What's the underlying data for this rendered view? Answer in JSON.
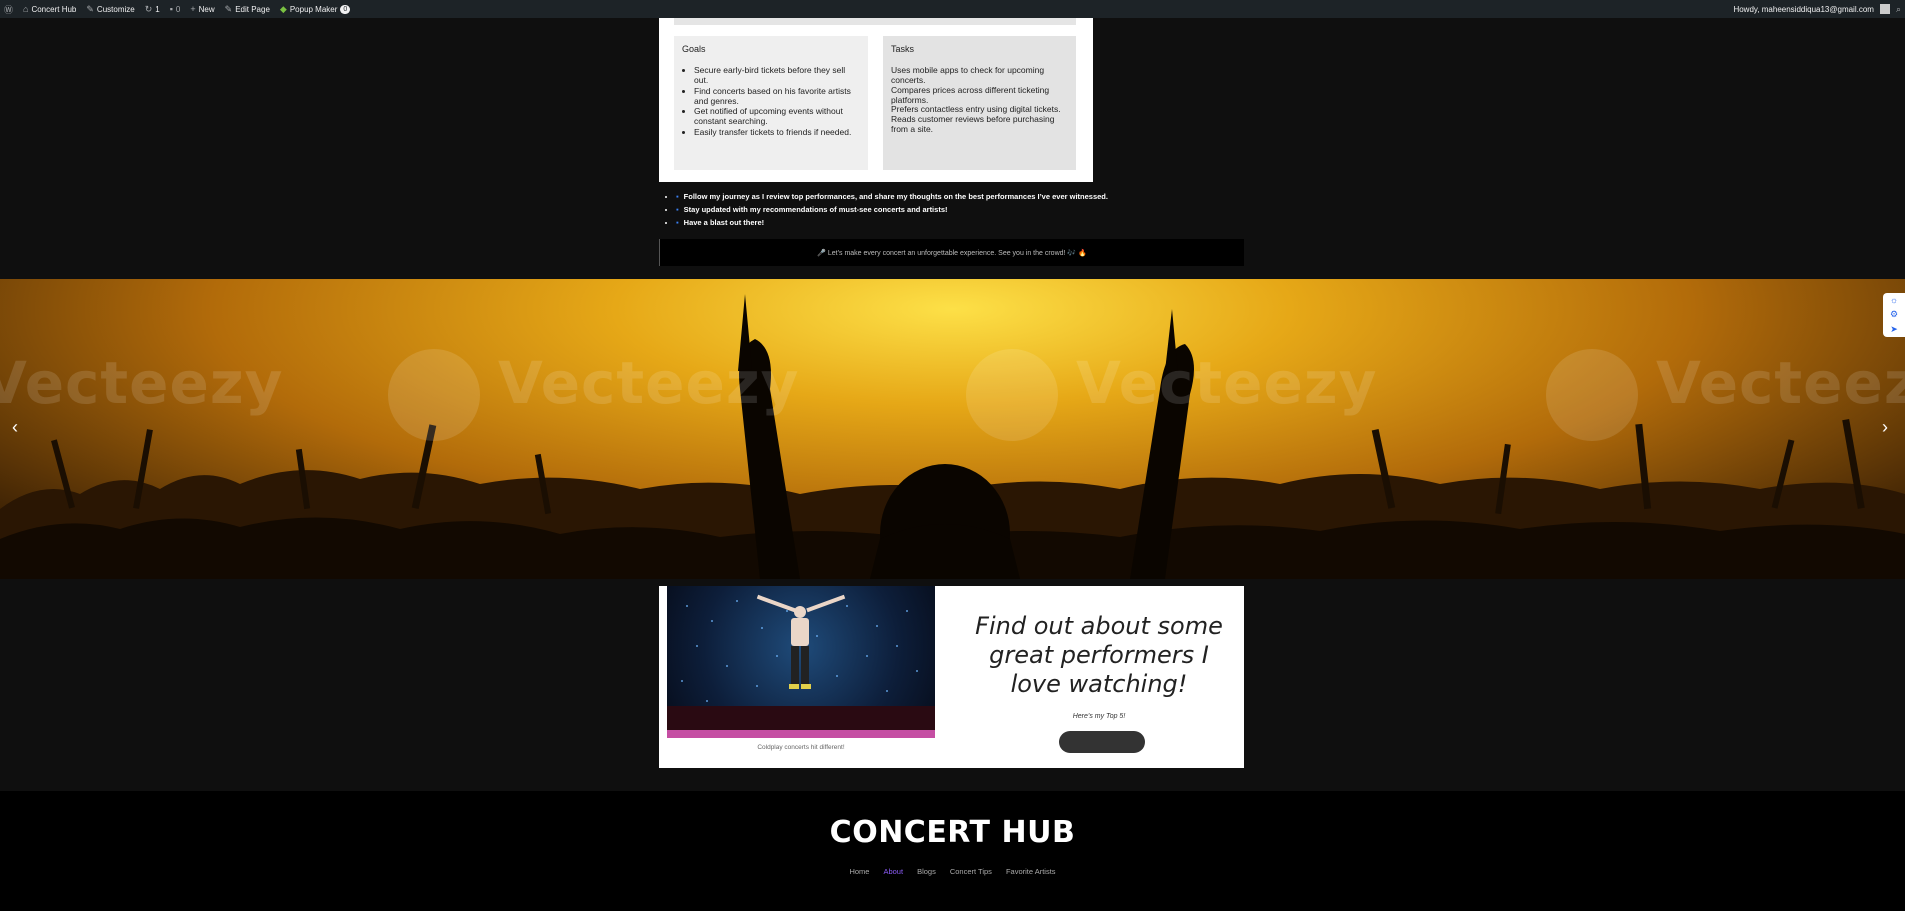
{
  "adminbar": {
    "site_name": "Concert Hub",
    "customize": "Customize",
    "updates_count": "1",
    "comments_count": "0",
    "new_label": "New",
    "edit_page": "Edit Page",
    "popup_maker": "Popup Maker",
    "popup_badge": "0",
    "howdy": "Howdy, maheensiddiqua13@gmail.com"
  },
  "persona": {
    "goals": {
      "heading": "Goals",
      "items": [
        "Secure early-bird tickets before they sell out.",
        "Find concerts based on his favorite artists and genres.",
        "Get notified of upcoming events without constant searching.",
        "Easily transfer tickets to friends if needed."
      ]
    },
    "tasks": {
      "heading": "Tasks",
      "lines": [
        "Uses mobile apps to check for upcoming concerts.",
        "Compares prices across different ticketing platforms.",
        "Prefers contactless entry using digital tickets.",
        "Reads customer reviews before purchasing from a site."
      ]
    }
  },
  "bullets": [
    "Follow my journey as I review top performances, and share my thoughts on the best performances I’ve ever witnessed.",
    "Stay updated with my recommendations of must-see concerts and artists!",
    "Have a blast out there!"
  ],
  "cta_text": "🎤 Let’s make every concert an unforgettable experience. See you in the crowd! 🎶 🔥",
  "hero": {
    "watermark": "Vecteezy",
    "prev_arrow": "‹",
    "next_arrow": "›"
  },
  "performers": {
    "caption": "Coldplay concerts hit different!",
    "title": "Find out about some great performers I love watching!",
    "subtitle": "Here’s my Top 5!"
  },
  "footer": {
    "title": "CONCERT HUB",
    "nav": [
      "Home",
      "About",
      "Blogs",
      "Concert Tips",
      "Favorite Artists"
    ]
  },
  "colors": {
    "nav_active": "#8b5cf6",
    "adminbar_bg": "#1d2327",
    "page_bg": "#0f0f0f"
  }
}
